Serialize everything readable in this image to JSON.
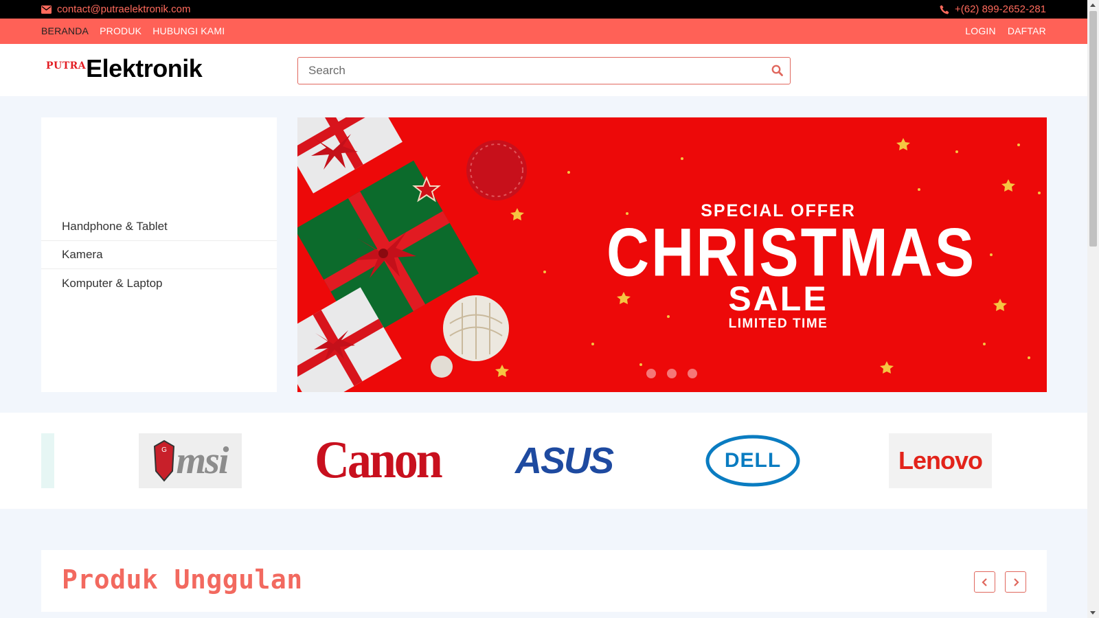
{
  "topbar": {
    "email": "contact@putraelektronik.com",
    "phone": "+(62) 899-2652-281",
    "email_icon": "envelope-icon",
    "phone_icon": "phone-icon"
  },
  "nav": {
    "items": [
      "BERANDA",
      "PRODUK",
      "HUBUNGI KAMI"
    ],
    "auth": [
      "LOGIN",
      "DAFTAR"
    ]
  },
  "logo": {
    "small": "PUTRA",
    "big": "Elektronik"
  },
  "search": {
    "placeholder": "Search",
    "value": "",
    "icon": "search-icon"
  },
  "categories": [
    "Handphone & Tablet",
    "Kamera",
    "Komputer & Laptop"
  ],
  "banner": {
    "line1": "SPECIAL OFFER",
    "line2": "CHRISTMAS",
    "line3": "SALE",
    "line4": "LIMITED TIME",
    "slide_count": 3
  },
  "brands": [
    "msi",
    "Canon",
    "ASUS",
    "DELL",
    "Lenovo"
  ],
  "featured": {
    "title": "Produk Unggulan",
    "prev_icon": "chevron-left-icon",
    "next_icon": "chevron-right-icon"
  },
  "colors": {
    "accent": "#ff6157",
    "topbar_bg": "#000000",
    "banner_red": "#ed0909",
    "title": "#f2695f"
  }
}
